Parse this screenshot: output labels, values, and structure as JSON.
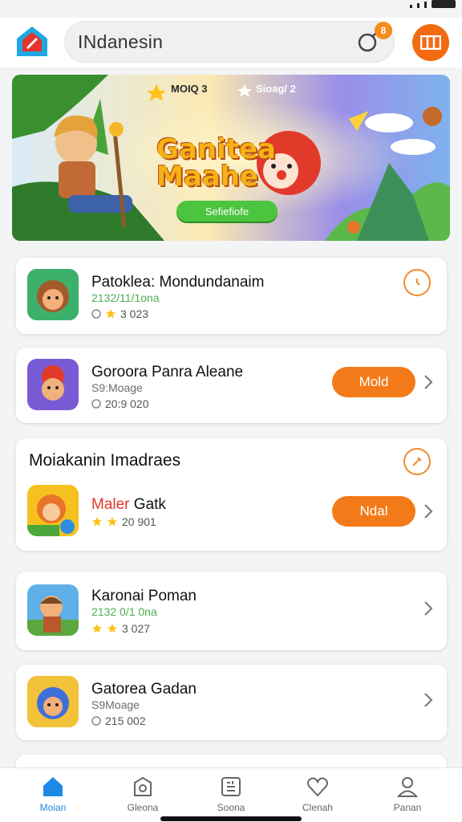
{
  "header": {
    "search_value": "INdanesin",
    "notification_count": "8"
  },
  "banner": {
    "label_left": "MOIQ 3",
    "label_right": "Sioag/ 2",
    "title_line1": "Ganitea",
    "title_line2": "Maahe",
    "cta_label": "Sefiefiofe"
  },
  "games": [
    {
      "title": "Patoklea: Mondundanaim",
      "subtitle": "2132/11/1ona",
      "meta": "3 023"
    },
    {
      "title": "Goroora Panra Aleane",
      "subtitle": "S9:Moage",
      "meta": "20:9 020",
      "button": "Mold"
    },
    {
      "title": "Karonai Poman",
      "subtitle": "2132 0/1 0na",
      "meta": "3 027"
    },
    {
      "title": "Gatorea Gadan",
      "subtitle": "S9Moage",
      "meta": "215 002"
    }
  ],
  "featured": {
    "section_title": "Moiakanin Imadraes",
    "title_red": "Maler",
    "title_rest": "Gatk",
    "meta": "20 901",
    "button": "Ndal"
  },
  "nav": [
    {
      "label": "Moian"
    },
    {
      "label": "Gleona"
    },
    {
      "label": "Soona"
    },
    {
      "label": "Clenah"
    },
    {
      "label": "Panan"
    }
  ],
  "colors": {
    "accent": "#f37a18",
    "nav_active": "#1e88e5",
    "badge": "#f48c1e"
  }
}
